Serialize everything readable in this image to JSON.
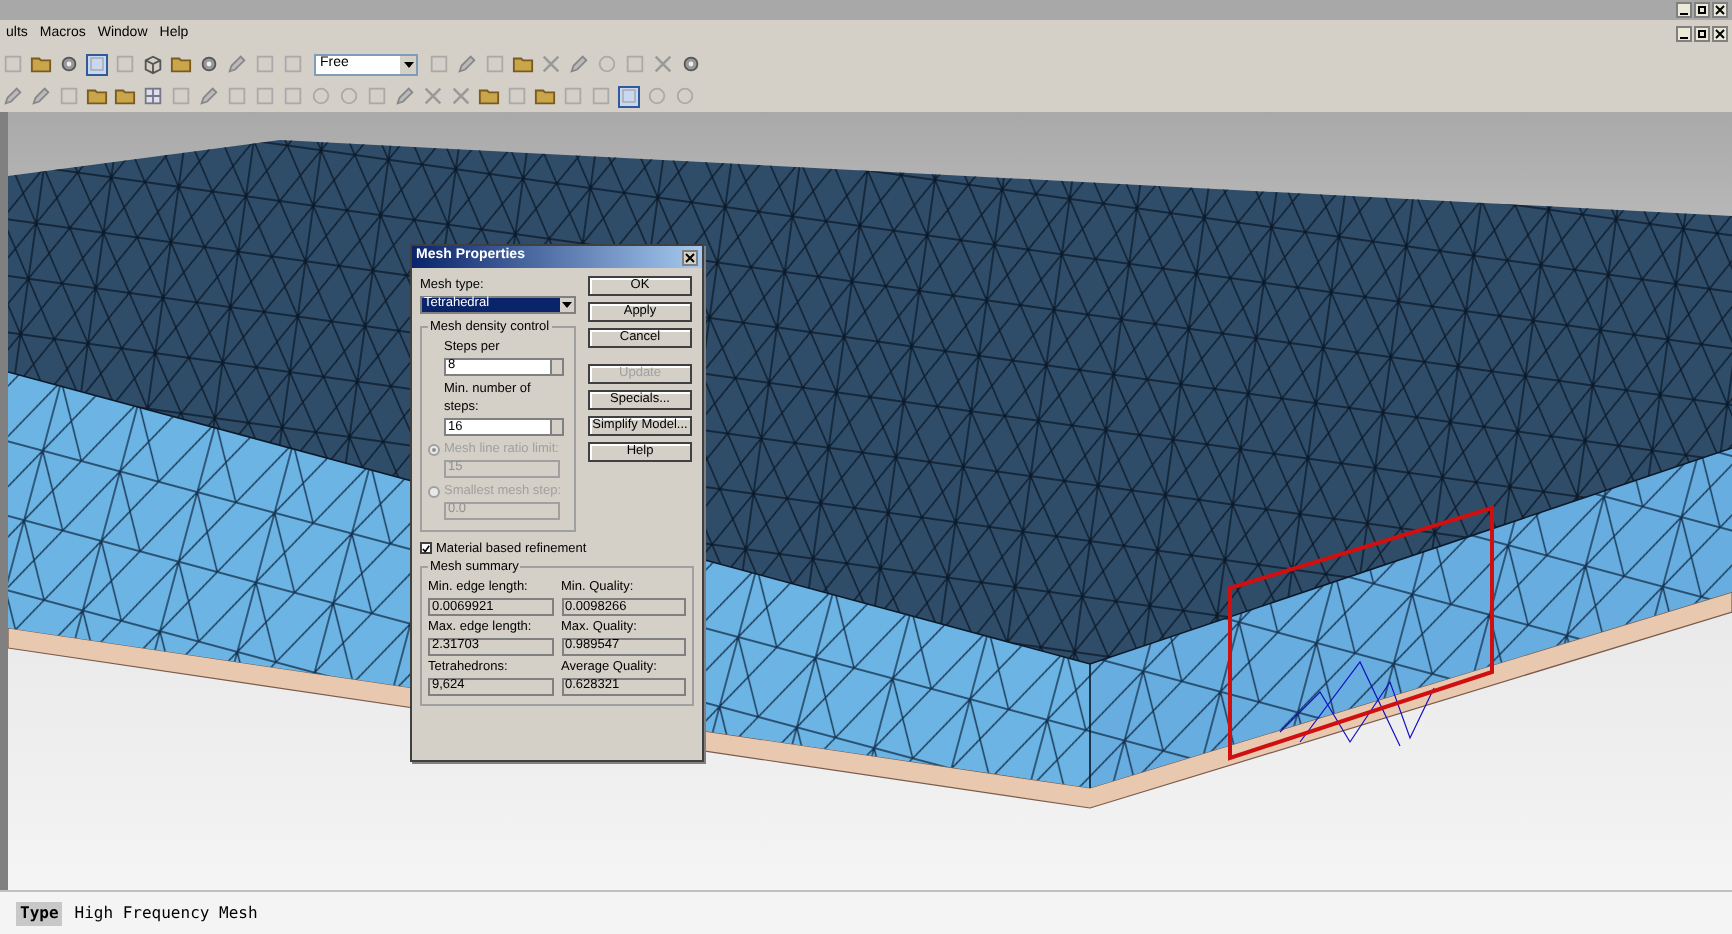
{
  "menu_bar": {
    "items": [
      "ults",
      "Macros",
      "Window",
      "Help"
    ]
  },
  "toolbar": {
    "view_mode": "Free"
  },
  "dialog": {
    "title": "Mesh Properties",
    "mesh_type": {
      "label": "Mesh type:",
      "value": "Tetrahedral"
    },
    "density_group": {
      "title": "Mesh density control",
      "fields": [
        {
          "label": "Steps per",
          "value": "8"
        },
        {
          "label": "Min. number of steps:",
          "value": "16"
        }
      ],
      "options": [
        {
          "label": "Mesh line ratio limit:",
          "value": "15",
          "selected": true,
          "disabled": true
        },
        {
          "label": "Smallest mesh step:",
          "value": "0.0",
          "selected": false,
          "disabled": true
        }
      ]
    },
    "refinement": {
      "label": "Material based refinement",
      "checked": true
    },
    "summary": {
      "title": "Mesh summary",
      "items": [
        {
          "label": "Min. edge length:",
          "value": "0.0069921"
        },
        {
          "label": "Min. Quality:",
          "value": "0.0098266"
        },
        {
          "label": "Max. edge length:",
          "value": "2.31703"
        },
        {
          "label": "Max. Quality:",
          "value": "0.989547"
        },
        {
          "label": "Tetrahedrons:",
          "value": "9,624"
        },
        {
          "label": "Average Quality:",
          "value": "0.628321"
        }
      ]
    },
    "buttons": [
      {
        "label": "OK",
        "disabled": false
      },
      {
        "label": "Apply",
        "disabled": false
      },
      {
        "label": "Cancel",
        "disabled": false
      },
      {
        "label": "Update",
        "disabled": true
      },
      {
        "label": "Specials...",
        "disabled": false
      },
      {
        "label": "Simplify Model...",
        "disabled": false
      },
      {
        "label": "Help",
        "disabled": false
      }
    ]
  },
  "status_bar": {
    "label": "Type",
    "value": "High Frequency Mesh"
  }
}
